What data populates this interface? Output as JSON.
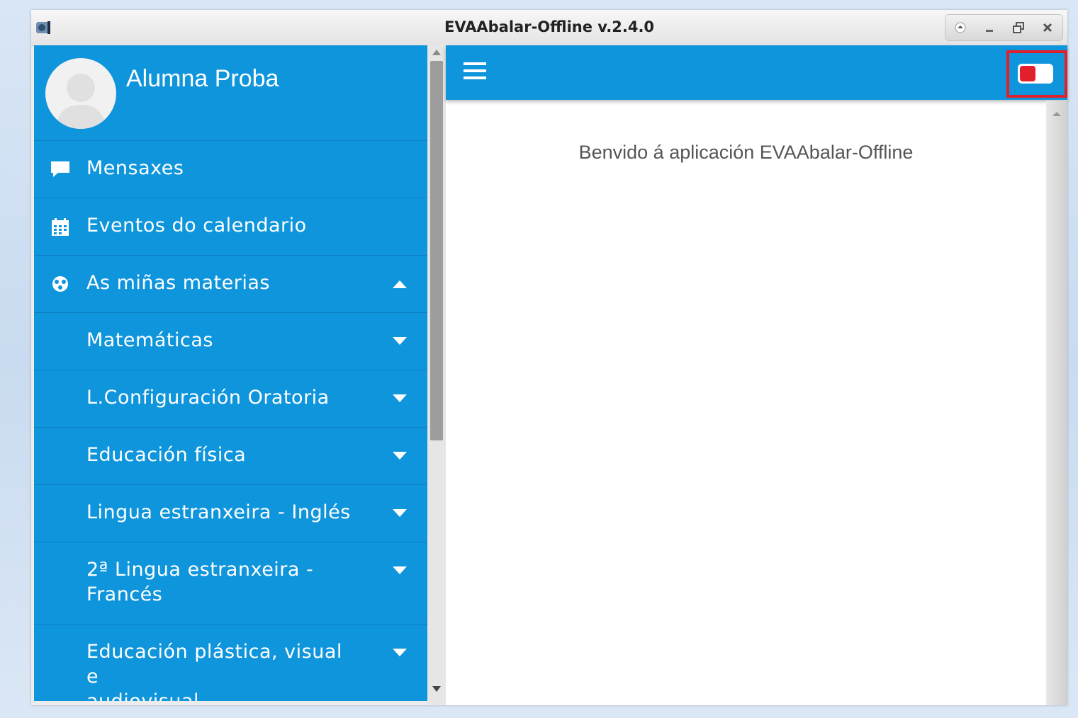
{
  "window": {
    "title": "EVAAbalar-Offline v.2.4.0",
    "controls": [
      "up-icon",
      "minimize-icon",
      "restore-icon",
      "close-icon"
    ]
  },
  "sidebar": {
    "user_name": "Alumna Proba",
    "items": [
      {
        "label": "Mensaxes",
        "icon": "chat-icon"
      },
      {
        "label": "Eventos do calendario",
        "icon": "calendar-icon"
      },
      {
        "label": "As miñas materias",
        "icon": "network-icon",
        "expanded": true
      }
    ],
    "subjects": [
      {
        "label": "Matemáticas"
      },
      {
        "label": "L.Configuración Oratoria"
      },
      {
        "label": "Educación física"
      },
      {
        "label": "Lingua estranxeira - Inglés"
      },
      {
        "label": "2ª Lingua estranxeira -",
        "label2": "Francés"
      },
      {
        "label": "Educación plástica, visual e",
        "label2": "audiovisual"
      }
    ]
  },
  "main": {
    "welcome_text": "Benvido á aplicación EVAAbalar-Offline",
    "toggle_state": "off"
  },
  "colors": {
    "accent": "#0f95dc",
    "toggle": "#e2202d",
    "highlight": "#e2202d"
  }
}
